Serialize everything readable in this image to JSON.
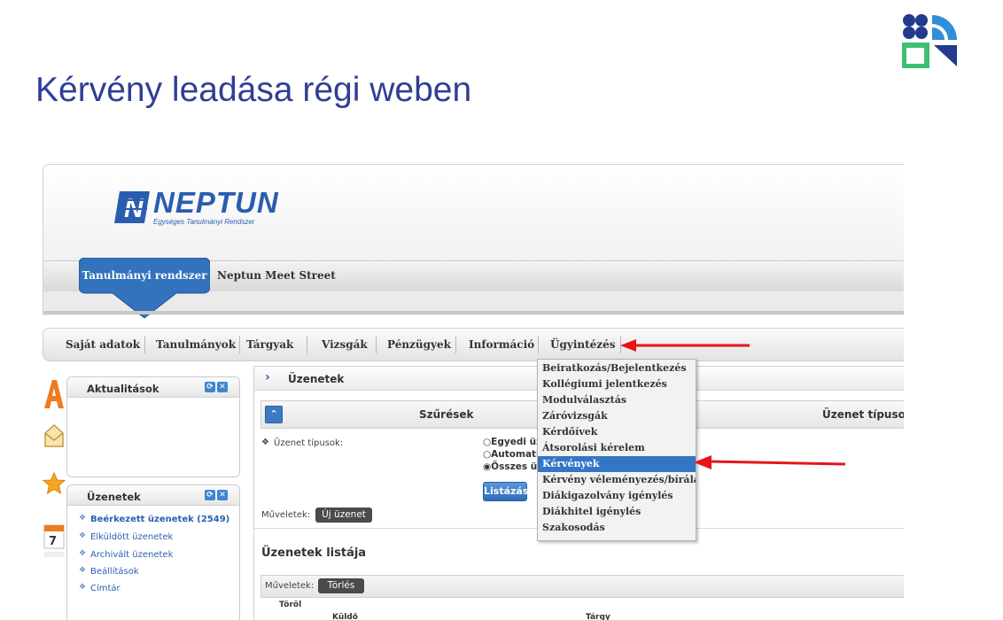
{
  "slide": {
    "title": "Kérvény leadása régi weben"
  },
  "app": {
    "brand": "NEPTUN",
    "brand_subtitle": "Egységes Tanulmányi Rendszer",
    "system_button": "Tanulmányi rendszer",
    "meet_street": "Neptun Meet Street"
  },
  "menu": {
    "items": [
      "Saját adatok",
      "Tanulmányok",
      "Tárgyak",
      "Vizsgák",
      "Pénzügyek",
      "Információ",
      "Ügyintézés"
    ]
  },
  "dropdown": {
    "items": [
      "Beiratkozás/Bejelentkezés",
      "Kollégiumi jelentkezés",
      "Modulválasztás",
      "Záróvizsgák",
      "Kérdőívek",
      "Átsorolási kérelem",
      "Kérvények",
      "Kérvény véleményezés/bírálás",
      "Diákigazolvány igénylés",
      "Diákhitel igénylés",
      "Szakosodás"
    ],
    "active": "Kérvények"
  },
  "side": {
    "news_title": "Aktualitások",
    "messages_title": "Üzenetek",
    "message_links": [
      "Beérkezett üzenetek (2549)",
      "Elküldött üzenetek",
      "Archivált üzenetek",
      "Beállítások",
      "Címtár"
    ],
    "calendar_day": "7"
  },
  "main": {
    "title": "Üzenetek",
    "filter_title": "Szűrések",
    "filter_right": "Üzenet típusok:",
    "type_label": "Üzenet típusok:",
    "radios": [
      "Egyedi üz",
      "Automati",
      "Összes üz"
    ],
    "radio_selected": "Összes üz",
    "list_button": "Listázás",
    "ops_label": "Műveletek:",
    "new_message_button": "Új üzenet",
    "list_title": "Üzenetek listája",
    "ops_label2": "Műveletek:",
    "delete_button": "Törlés",
    "col_delete": "Töröl",
    "col_sender": "Küldő",
    "col_subject": "Tárgy"
  },
  "colors": {
    "title": "#2f3e96",
    "neptun_blue": "#2a5db0",
    "active_item": "#3377c4",
    "arrow": "#e8141b"
  }
}
